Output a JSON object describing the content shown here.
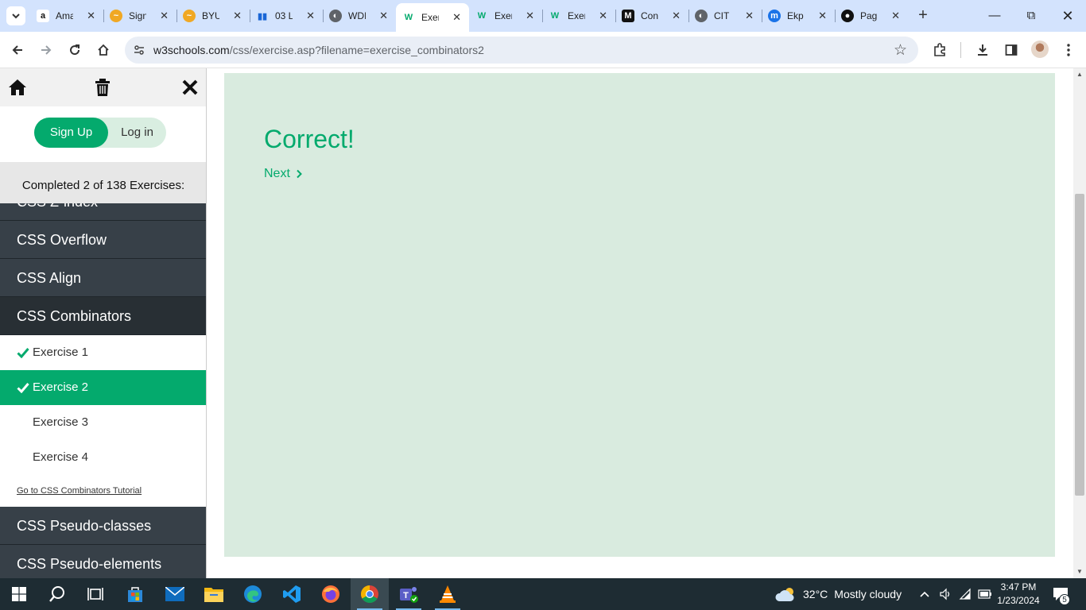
{
  "browser": {
    "tabs": [
      {
        "title": "Ama",
        "favicon": "amazon-icon",
        "active": false
      },
      {
        "title": "Sign",
        "favicon": "byu-sign-icon",
        "active": false
      },
      {
        "title": "BYU",
        "favicon": "byu-icon",
        "active": false
      },
      {
        "title": "03 L",
        "favicon": "chart-bars-icon",
        "active": false
      },
      {
        "title": "WDI",
        "favicon": "globe-icon",
        "active": false
      },
      {
        "title": "Exer",
        "favicon": "w3schools-icon",
        "active": true
      },
      {
        "title": "Exer",
        "favicon": "w3schools-icon",
        "active": false
      },
      {
        "title": "Exer",
        "favicon": "w3schools-icon",
        "active": false
      },
      {
        "title": "Con",
        "favicon": "m-logo-icon",
        "active": false
      },
      {
        "title": "CIT",
        "favicon": "globe-icon",
        "active": false
      },
      {
        "title": "Ekp",
        "favicon": "m-blue-icon",
        "active": false
      },
      {
        "title": "Pag",
        "favicon": "github-icon",
        "active": false
      }
    ],
    "url_host": "w3schools.com",
    "url_path": "/css/exercise.asp?filename=exercise_combinators2"
  },
  "sidebar": {
    "signup_label": "Sign Up",
    "login_label": "Log in",
    "progress_text": "Completed 2 of 138 Exercises:",
    "chapters_before": [
      "CSS Z-index",
      "CSS Overflow",
      "CSS Align"
    ],
    "current_chapter": "CSS Combinators",
    "exercises": [
      {
        "label": "Exercise 1",
        "completed": true,
        "active": false
      },
      {
        "label": "Exercise 2",
        "completed": true,
        "active": true
      },
      {
        "label": "Exercise 3",
        "completed": false,
        "active": false
      },
      {
        "label": "Exercise 4",
        "completed": false,
        "active": false
      }
    ],
    "tutorial_link": "Go to CSS Combinators Tutorial",
    "chapters_after": [
      "CSS Pseudo-classes",
      "CSS Pseudo-elements"
    ]
  },
  "main": {
    "result_text": "Correct!",
    "next_label": "Next"
  },
  "taskbar": {
    "weather_temp": "32°C",
    "weather_desc": "Mostly cloudy",
    "time": "3:47 PM",
    "date": "1/23/2024",
    "notification_count": "5"
  },
  "colors": {
    "accent": "#04aa6d",
    "result_bg": "#d9ebdf",
    "sidebar_dark": "#374048"
  }
}
